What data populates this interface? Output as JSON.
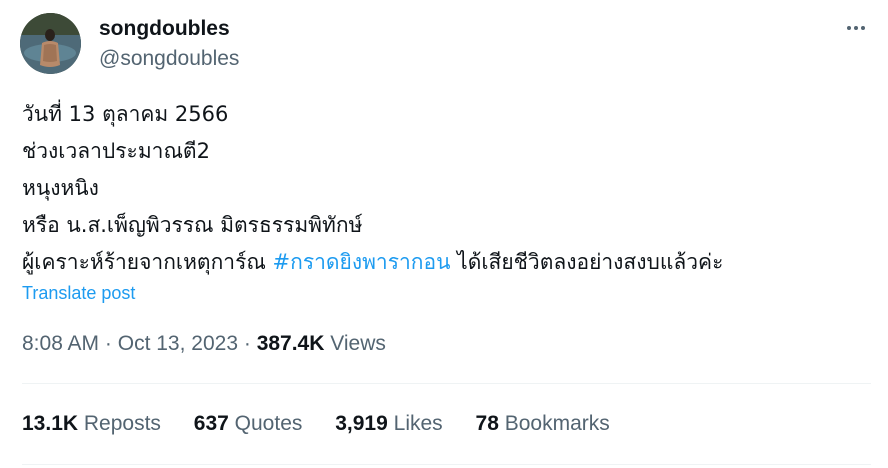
{
  "user": {
    "display_name": "songdoubles",
    "handle": "@songdoubles"
  },
  "tweet": {
    "lines": [
      "วันที่ 13 ตุลาคม 2566",
      "ช่วงเวลาประมาณตี2",
      "หนุงหนิง",
      "หรือ น.ส.เพ็ญพิวรรณ มิตรธรรมพิทักษ์"
    ],
    "last_line_prefix": "ผู้เคราะห์ร้ายจากเหตุการ์ณ ",
    "hashtag": "#กราดยิงพารากอน",
    "last_line_suffix": " ได้เสียชีวิตลงอย่างสงบแล้วค่ะ",
    "translate_label": "Translate post",
    "time": "8:08 AM",
    "date": "Oct 13, 2023",
    "separator": "·",
    "views_count": "387.4K",
    "views_label": "Views"
  },
  "stats": {
    "reposts_count": "13.1K",
    "reposts_label": "Reposts",
    "quotes_count": "637",
    "quotes_label": "Quotes",
    "likes_count": "3,919",
    "likes_label": "Likes",
    "bookmarks_count": "78",
    "bookmarks_label": "Bookmarks"
  },
  "icons": {
    "more": "more-horizontal-icon"
  },
  "colors": {
    "text": "#0f1419",
    "secondary": "#536471",
    "accent": "#1d9bf0",
    "divider": "#eff3f4"
  }
}
